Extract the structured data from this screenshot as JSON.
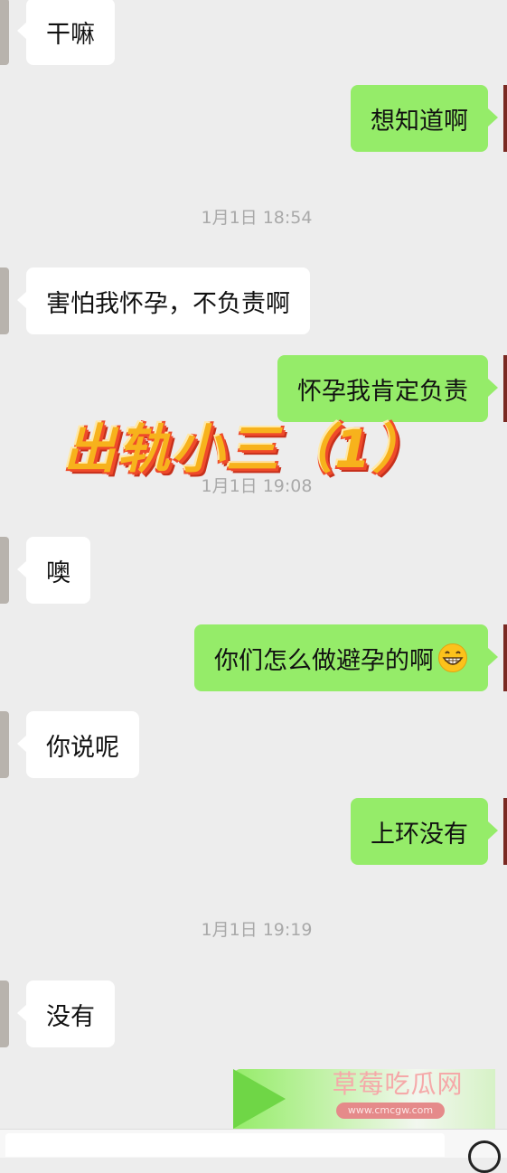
{
  "messages": [
    {
      "side": "in",
      "text": "干嘛"
    },
    {
      "side": "out",
      "text": "想知道啊"
    },
    {
      "side": "time",
      "text": "1月1日 18:54"
    },
    {
      "side": "in",
      "text": "害怕我怀孕，不负责啊"
    },
    {
      "side": "out",
      "text": "怀孕我肯定负责"
    },
    {
      "side": "time",
      "text": "1月1日 19:08"
    },
    {
      "side": "in",
      "text": "噢"
    },
    {
      "side": "out",
      "text": "你们怎么做避孕的啊",
      "emoji": "grinning-face-emoji"
    },
    {
      "side": "in",
      "text": "你说呢"
    },
    {
      "side": "out",
      "text": "上环没有"
    },
    {
      "side": "time",
      "text": "1月1日 19:19"
    },
    {
      "side": "in",
      "text": "没有"
    }
  ],
  "overlay_title": "出轨小三（1）",
  "watermark": {
    "name": "草莓吃瓜网",
    "url": "www.cmcgw.com"
  },
  "colors": {
    "background": "#ededed",
    "outgoing_bubble": "#95ec69",
    "incoming_bubble": "#ffffff",
    "timestamp": "#a9a9a9",
    "overlay": "#f7b21c"
  },
  "input": {
    "icon": "voice-icon"
  }
}
